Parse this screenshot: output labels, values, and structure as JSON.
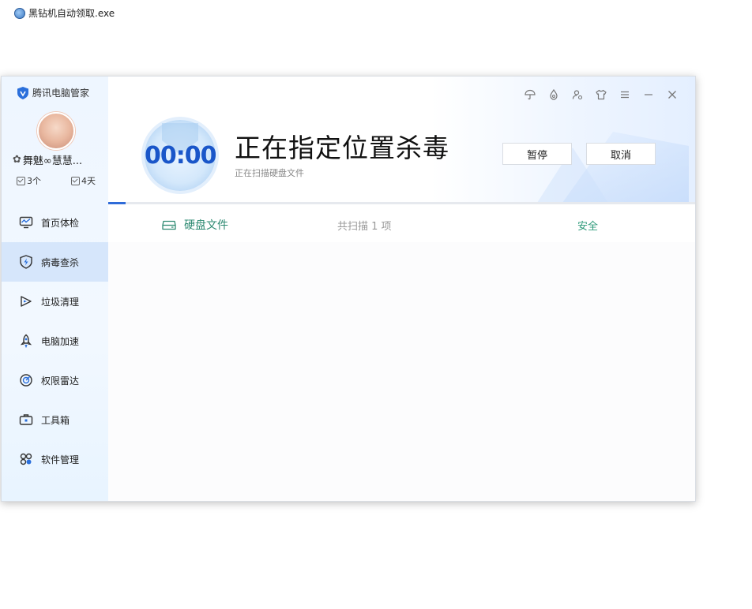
{
  "desktop": {
    "shortcut_label": "黑钻机自动领取.exe"
  },
  "brand": {
    "name": "腾讯电脑管家"
  },
  "user": {
    "name": "舞魅∞慧慧...",
    "stat_a": "3个",
    "stat_b": "4天"
  },
  "nav": [
    {
      "label": "首页体检",
      "icon": "monitor-icon"
    },
    {
      "label": "病毒查杀",
      "icon": "shield-lightning-icon"
    },
    {
      "label": "垃圾清理",
      "icon": "broom-icon"
    },
    {
      "label": "电脑加速",
      "icon": "rocket-icon"
    },
    {
      "label": "权限雷达",
      "icon": "radar-icon"
    },
    {
      "label": "工具箱",
      "icon": "toolbox-icon"
    },
    {
      "label": "软件管理",
      "icon": "apps-icon"
    }
  ],
  "scan": {
    "timer": "00:00",
    "title": "正在指定位置杀毒",
    "subtitle": "正在扫描硬盘文件",
    "pause_label": "暂停",
    "cancel_label": "取消",
    "progress_fraction": 0.03
  },
  "result_row": {
    "name": "硬盘文件",
    "count": "共扫描 1 项",
    "status": "安全"
  },
  "colors": {
    "accent": "#2f6bd8",
    "safe": "#2e9a7a",
    "active_nav": "#d6e6fb"
  }
}
